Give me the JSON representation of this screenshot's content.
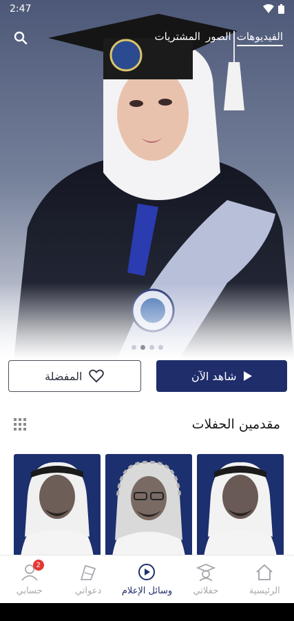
{
  "status": {
    "time": "2:47"
  },
  "top_nav": {
    "links": [
      "الفيديوهات",
      "الصور",
      "المشتريات"
    ],
    "active_index": 0
  },
  "carousel": {
    "dots": 4,
    "active_index": 1
  },
  "actions": {
    "watch_label": "شاهد الآن",
    "favorite_label": "المفضلة"
  },
  "section": {
    "title": "مقدمين الحفلات"
  },
  "bottom_nav": {
    "tabs": [
      {
        "label": "الرئيسية",
        "icon": "home-icon"
      },
      {
        "label": "حفلاتي",
        "icon": "graduation-icon"
      },
      {
        "label": "وسائل الإعلام",
        "icon": "media-play-icon"
      },
      {
        "label": "دعواتي",
        "icon": "invitations-icon"
      },
      {
        "label": "حسابي",
        "icon": "account-icon",
        "badge": "2"
      }
    ],
    "active_index": 2
  },
  "colors": {
    "primary": "#1f2d6b",
    "badge": "#e53935",
    "inactive": "#a7a9b0"
  }
}
